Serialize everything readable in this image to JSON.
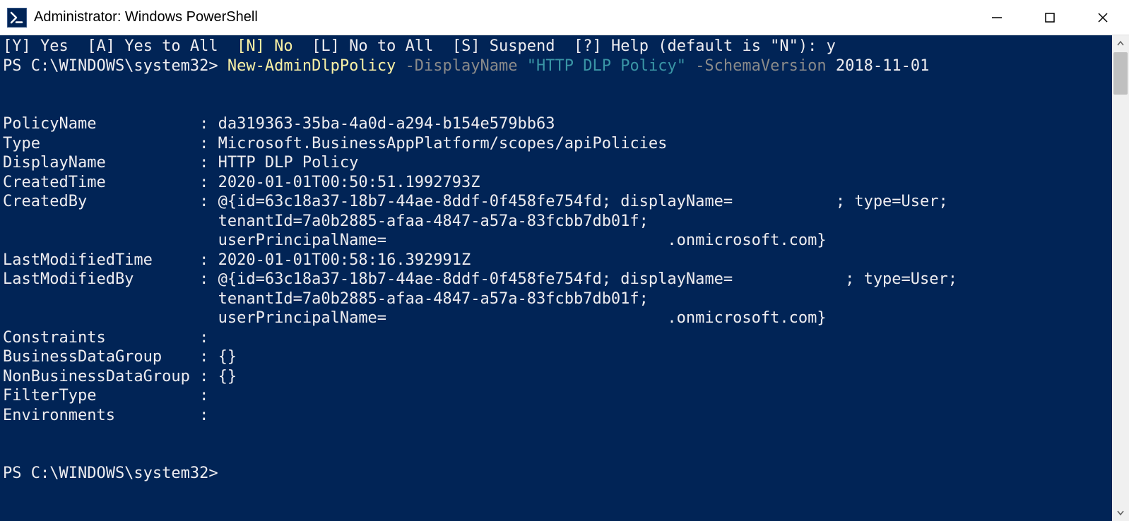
{
  "titlebar": {
    "text": "Administrator: Windows PowerShell"
  },
  "confirm_line": {
    "opt_y": "[Y] Yes",
    "opt_a": "[A] Yes to All",
    "opt_n": "[N] No",
    "opt_l": "[L] No to All",
    "opt_s": "[S] Suspend",
    "opt_help": "[?] Help (default is \"N\"):",
    "answer": "y"
  },
  "cmd": {
    "prompt": "PS C:\\WINDOWS\\system32>",
    "cmdlet": "New-AdminDlpPolicy",
    "param1": "-DisplayName",
    "val1": "\"HTTP DLP Policy\"",
    "param2": "-SchemaVersion",
    "val2": "2018-11-01"
  },
  "out": {
    "PolicyName_k": "PolicyName          ",
    "PolicyName_v": "da319363-35ba-4a0d-a294-b154e579bb63",
    "Type_k": "Type                ",
    "Type_v": "Microsoft.BusinessAppPlatform/scopes/apiPolicies",
    "DisplayName_k": "DisplayName         ",
    "DisplayName_v": "HTTP DLP Policy",
    "CreatedTime_k": "CreatedTime         ",
    "CreatedTime_v": "2020-01-01T00:50:51.1992793Z",
    "CreatedBy_k": "CreatedBy           ",
    "CreatedBy_l1": "@{id=63c18a37-18b7-44ae-8ddf-0f458fe754fd; displayName=           ; type=User;",
    "CreatedBy_l2": "                       tenantId=7a0b2885-afaa-4847-a57a-83fcbb7db01f;",
    "CreatedBy_l3": "                       userPrincipalName=                              .onmicrosoft.com}",
    "LastModTime_k": "LastModifiedTime    ",
    "LastModTime_v": "2020-01-01T00:58:16.392991Z",
    "LastModBy_k": "LastModifiedBy      ",
    "LastModBy_l1": "@{id=63c18a37-18b7-44ae-8ddf-0f458fe754fd; displayName=            ; type=User;",
    "LastModBy_l2": "                       tenantId=7a0b2885-afaa-4847-a57a-83fcbb7db01f;",
    "LastModBy_l3": "                       userPrincipalName=                              .onmicrosoft.com}",
    "Constraints_k": "Constraints         ",
    "Constraints_v": "",
    "BDG_k": "BusinessDataGroup   ",
    "BDG_v": "{}",
    "NBDG_k": "NonBusinessDataGroup",
    "NBDG_v": "{}",
    "FilterType_k": "FilterType          ",
    "FilterType_v": "",
    "Environments_k": "Environments        ",
    "Environments_v": ""
  },
  "prompt2": "PS C:\\WINDOWS\\system32>"
}
